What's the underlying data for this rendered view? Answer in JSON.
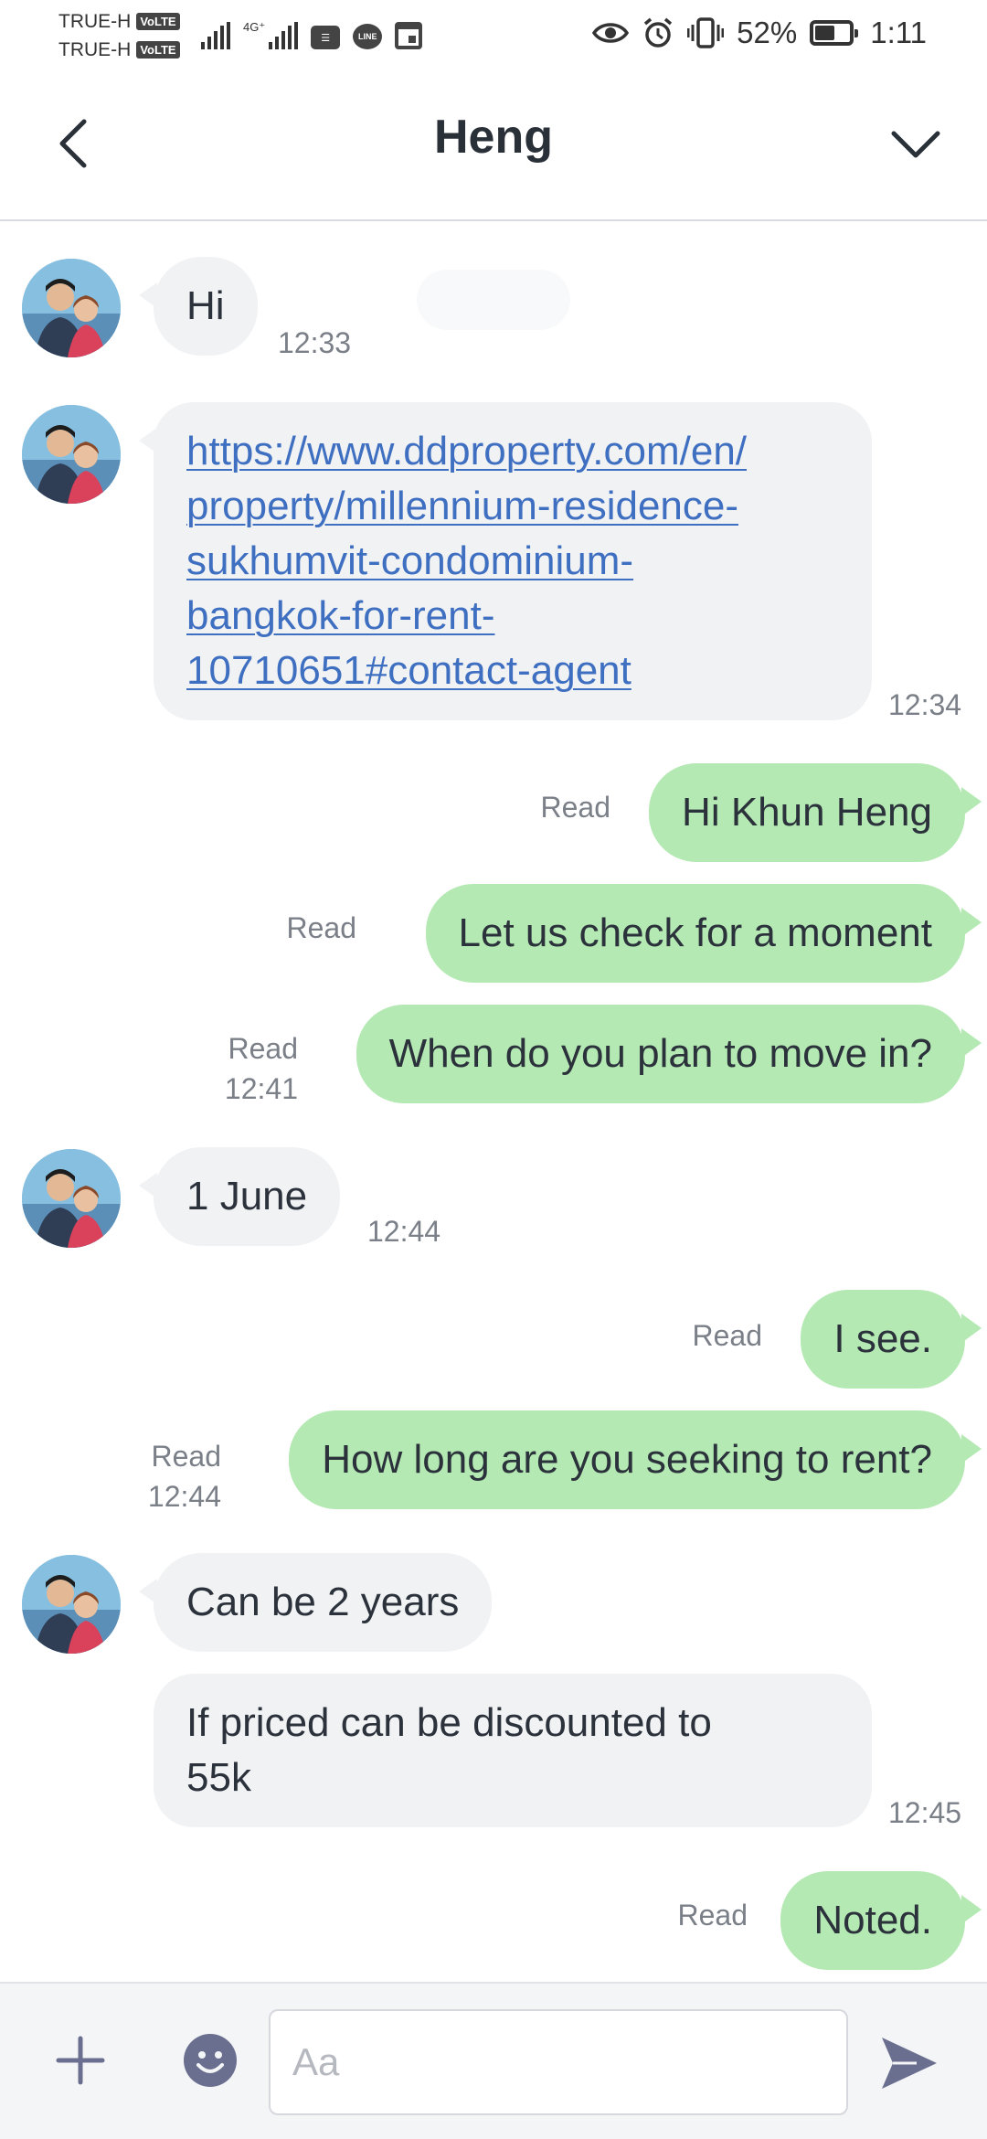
{
  "status_bar": {
    "carrier_1": "TRUE-H",
    "carrier_2": "TRUE-H",
    "volte_badge": "VoLTE",
    "network_type": "4G⁺",
    "line_badge": "LINE",
    "battery_percent": "52%",
    "time": "1:11",
    "icons": [
      "signal-icon",
      "signal-4g-icon",
      "app-notification-icon",
      "line-notification-icon",
      "calendar-icon",
      "eye-comfort-icon",
      "alarm-icon",
      "vibrate-icon",
      "battery-icon"
    ]
  },
  "header": {
    "title": "Heng",
    "back_icon": "chevron-left-icon",
    "expand_icon": "chevron-down-icon"
  },
  "colors": {
    "incoming_bubble": "#f1f2f4",
    "outgoing_bubble": "#b5e9b3",
    "link": "#3e6fc1",
    "meta_text": "#7a7f88",
    "accent_icon": "#6b6f8f"
  },
  "messages": [
    {
      "direction": "in",
      "text": "Hi",
      "time": "12:33"
    },
    {
      "direction": "in",
      "link": "https://www.ddproperty.com/en/property/millennium-residence-sukhumvit-condominium-bangkok-for-rent-10710651#contact-agent",
      "link_lines": [
        "https://www.ddproperty.com/en/",
        "property/millennium-residence-",
        "sukhumvit-condominium-",
        "bangkok-for-rent-",
        "10710651#contact-agent"
      ],
      "time": "12:34"
    },
    {
      "direction": "out",
      "text": "Hi Khun Heng",
      "status": "Read"
    },
    {
      "direction": "out",
      "text": "Let us check for a moment",
      "status": "Read"
    },
    {
      "direction": "out",
      "text": "When do you plan to move in?",
      "status": "Read",
      "time": "12:41"
    },
    {
      "direction": "in",
      "text": "1 June",
      "time": "12:44"
    },
    {
      "direction": "out",
      "text": "I see.",
      "status": "Read"
    },
    {
      "direction": "out",
      "text": "How long are you seeking to rent?",
      "status": "Read",
      "time": "12:44"
    },
    {
      "direction": "in",
      "text": "Can be 2 years"
    },
    {
      "direction": "in",
      "text_lines": [
        "If priced can be discounted to",
        "55k"
      ],
      "time": "12:45"
    },
    {
      "direction": "out",
      "text": "Noted.",
      "status": "Read"
    }
  ],
  "input_bar": {
    "placeholder": "Aa",
    "value": "",
    "plus_icon": "plus-icon",
    "emoji_icon": "emoji-icon",
    "send_icon": "send-icon"
  }
}
